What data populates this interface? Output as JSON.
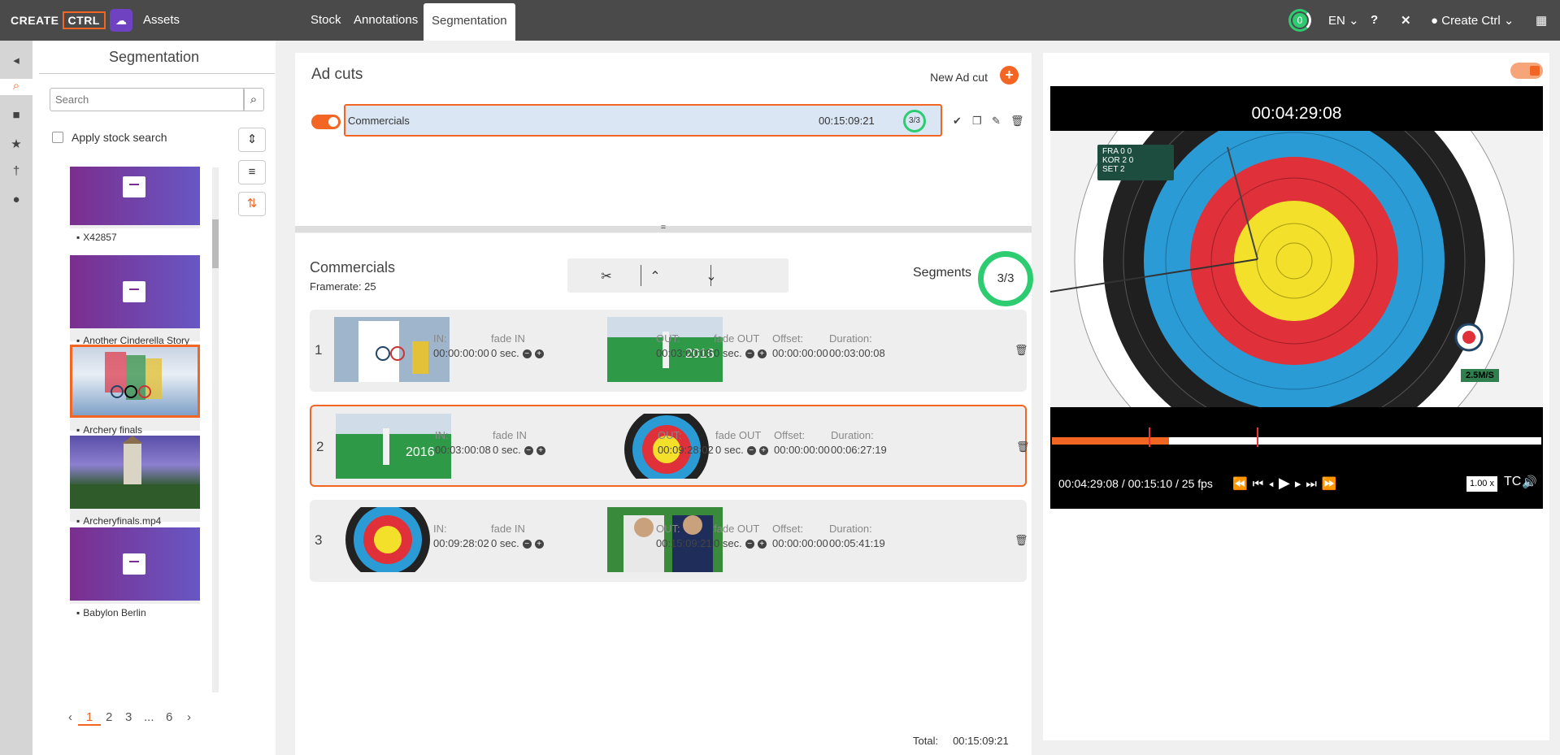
{
  "topbar": {
    "logo_left": "CREATE",
    "logo_right": "CTRL",
    "assets_label": "Assets",
    "tabs": [
      {
        "label": "Stock"
      },
      {
        "label": "Annotations"
      },
      {
        "label": "Segmentation"
      }
    ],
    "notification_count": "0",
    "language": "EN ⌄",
    "user": "Create Ctrl ⌄",
    "icons": [
      "help-icon",
      "tools-icon",
      "user-icon",
      "apps-grid-icon"
    ]
  },
  "rail": {
    "items": [
      {
        "icon": "collapse-icon",
        "glyph": "◂"
      },
      {
        "icon": "search-icon",
        "glyph": "⌕"
      },
      {
        "icon": "folder-icon",
        "glyph": "■"
      },
      {
        "icon": "star-icon",
        "glyph": "★"
      },
      {
        "icon": "pin-icon",
        "glyph": "†"
      },
      {
        "icon": "person-icon",
        "glyph": "●"
      }
    ]
  },
  "left_panel": {
    "title": "Segmentation",
    "search_placeholder": "Search",
    "apply_stock_search": "Apply stock search",
    "assets": [
      {
        "name": "X42857"
      },
      {
        "name": "Another Cinderella Story"
      },
      {
        "name": "Archery finals"
      },
      {
        "name": "Archeryfinals.mp4"
      },
      {
        "name": "Babylon Berlin"
      }
    ],
    "pagination": [
      "1",
      "2",
      "3",
      "...",
      "6"
    ]
  },
  "ad_cuts": {
    "title": "Ad cuts",
    "new_label": "New Ad cut",
    "cut": {
      "name": "Commercials",
      "duration": "00:15:09:21",
      "count": "3/3"
    }
  },
  "segments_panel": {
    "title": "Commercials",
    "framerate": "Framerate: 25",
    "segments_label": "Segments",
    "count": "3/3",
    "labels": {
      "in": "IN:",
      "fade_in": "fade IN",
      "out": "OUT:",
      "fade_out": "fade OUT",
      "offset": "Offset:",
      "duration": "Duration:"
    },
    "rows": [
      {
        "num": "1",
        "in": "00:00:00:00",
        "fade_in": "0 sec.",
        "out": "00:03:00:08",
        "fade_out": "0 sec.",
        "offset": "00:00:00:00",
        "duration": "00:03:00:08"
      },
      {
        "num": "2",
        "in": "00:03:00:08",
        "fade_in": "0 sec.",
        "out": "00:09:28:02",
        "fade_out": "0 sec.",
        "offset": "00:00:00:00",
        "duration": "00:06:27:19"
      },
      {
        "num": "3",
        "in": "00:09:28:02",
        "fade_in": "0 sec.",
        "out": "00:15:09:21",
        "fade_out": "0 sec.",
        "offset": "00:00:00:00",
        "duration": "00:05:41:19"
      }
    ],
    "total_label": "Total:",
    "total_value": "00:15:09:21"
  },
  "player": {
    "timecode": "00:04:29:08",
    "status": "00:04:29:08 / 00:15:10 / 25 fps",
    "progress_fraction": 0.24,
    "markers": [
      0.198,
      0.418
    ],
    "speed": "1.00 x",
    "tc_label": "TC",
    "scoreboard": [
      "FRA  0  0",
      "KOR  2  0",
      "SET 2"
    ],
    "wind": "2.5M/S"
  },
  "colors": {
    "accent": "#f26522",
    "ok": "#2ecc71",
    "brand": "#6f42c1"
  }
}
